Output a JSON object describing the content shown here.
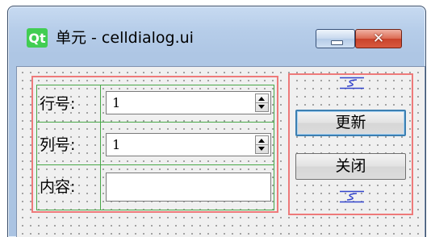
{
  "window": {
    "logo_text": "Qt",
    "title": "单元 - celldialog.ui",
    "controls": [
      "minimize-icon",
      "close-icon"
    ]
  },
  "form": {
    "row_label": "行号:",
    "row_value": "1",
    "column_label": "列号:",
    "column_value": "1",
    "content_label": "内容:",
    "content_value": ""
  },
  "buttons": {
    "update": "更新",
    "close": "关闭"
  },
  "colors": {
    "layout_border": "#ee7a7a",
    "form_grid": "#48a848",
    "spacer": "#3344cc",
    "default_button_border": "#3c7fb1",
    "qt_green": "#41cd52"
  }
}
